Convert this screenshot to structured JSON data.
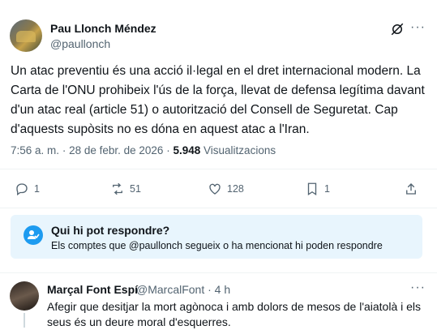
{
  "tweet": {
    "author_name": "Pau Llonch Méndez",
    "author_handle": "@paullonch",
    "text": "Un atac preventiu és una acció il·legal en el dret internacional modern. La Carta de l'ONU prohibeix l'ús de la força, llevat de defensa legítima davant d'un atac real (article 51) o autorització del Consell de Seguretat. Cap d'aquests supòsits no es dóna en aquest atac a l'Iran.",
    "time": "7:56 a. m.",
    "sep1": "·",
    "date": "28 de febr. de 2026",
    "sep2": "·",
    "views_count": "5.948",
    "views_label": "Visualitzacions",
    "more_icon": "more-icon",
    "grok_icon": "grok-icon"
  },
  "actions": {
    "replies": "1",
    "reposts": "51",
    "likes": "128",
    "bookmarks": "1"
  },
  "reply_settings": {
    "title": "Qui hi pot respondre?",
    "subtitle": "Els comptes que @paullonch segueix o ha mencionat hi poden respondre"
  },
  "reply": {
    "author_name": "Marçal Font Espí",
    "author_handle": "@MarcalFont · 4 h",
    "text": "Afegir que desitjar la mort agònoca i amb dolors de mesos de l'aiatolà i els seus és un deure moral d'esquerres."
  },
  "colors": {
    "accent": "#1d9bf0",
    "muted": "#536471",
    "reply_box_bg": "#e8f5fd"
  }
}
